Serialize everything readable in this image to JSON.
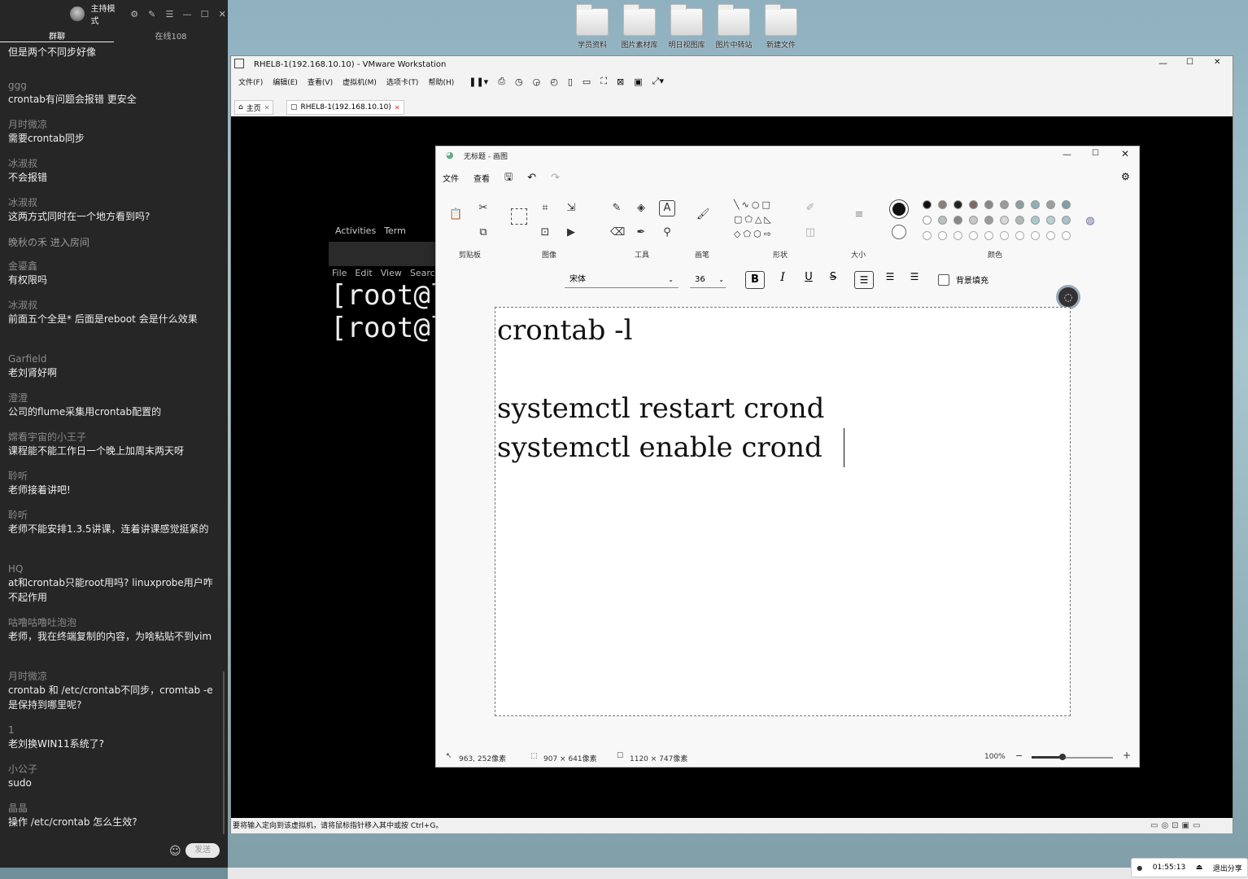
{
  "chat": {
    "mode_label": "主持模式",
    "tabs": [
      "群聊",
      "在线108"
    ],
    "messages": [
      {
        "name": "",
        "text": "但是两个不同步好像"
      },
      {
        "name": "ggg",
        "text": "crontab有问题会报错  更安全"
      },
      {
        "name": "月时微凉",
        "text": "需要crontab同步"
      },
      {
        "name": "冰淑叔",
        "text": "不会报错"
      },
      {
        "name": "冰淑叔",
        "text": "这两方式同时在一个地方看到吗?"
      },
      {
        "name": "",
        "text": "晚秋の禾 进入房间"
      },
      {
        "name": "金鎏鑫",
        "text": "有权限吗"
      },
      {
        "name": "冰淑叔",
        "text": "前面五个全是*  后面是reboot  会是什么效果"
      },
      {
        "name": "Garfield",
        "text": "老刘肾好啊"
      },
      {
        "name": "澄澄",
        "text": "公司的flume采集用crontab配置的"
      },
      {
        "name": "嫦看宇宙的小王子",
        "text": "课程能不能工作日一个晚上加周末两天呀"
      },
      {
        "name": "聆听",
        "text": "老师接着讲吧!"
      },
      {
        "name": "聆听",
        "text": "老师不能安排1.3.5讲课，连着讲课感觉挺紧的"
      },
      {
        "name": "HQ",
        "text": "at和crontab只能root用吗? linuxprobe用户咋不起作用"
      },
      {
        "name": "咕噜咕噜吐泡泡",
        "text": "老师，我在终端复制的内容，为啥粘贴不到vim"
      },
      {
        "name": "月时微凉",
        "text": "crontab 和 /etc/crontab不同步，cromtab -e是保持到哪里呢?"
      },
      {
        "name": "1",
        "text": "老刘换WIN11系统了?"
      },
      {
        "name": "小公子",
        "text": "sudo"
      },
      {
        "name": "晶晶",
        "text": "操作 /etc/crontab 怎么生效?"
      }
    ],
    "send_label": "发送"
  },
  "desktop": {
    "icons": [
      "学员资料",
      "图片素材库",
      "明日视图库",
      "图片中转站",
      "新建文件"
    ]
  },
  "vmware": {
    "title": "RHEL8-1(192.168.10.10) - VMware Workstation",
    "menu": [
      "文件(F)",
      "编辑(E)",
      "查看(V)",
      "虚拟机(M)",
      "选项卡(T)",
      "帮助(H)"
    ],
    "tabs": [
      "主页",
      "RHEL8-1(192.168.10.10)"
    ],
    "status": "要将输入定向到该虚拟机，请将鼠标指针移入其中或按 Ctrl+G。",
    "guest": {
      "activities": "Activities",
      "terminal_app": "Term",
      "term_menu": [
        "File",
        "Edit",
        "View",
        "Searc"
      ],
      "prompt_lines": [
        "[root@l",
        "[root@l"
      ]
    }
  },
  "paint": {
    "title": "无标题 - 画图",
    "menu": [
      "文件",
      "查看"
    ],
    "groups": [
      "剪贴板",
      "图像",
      "工具",
      "画笔",
      "形状",
      "大小",
      "颜色"
    ],
    "font_name": "宋体",
    "font_size": "36",
    "bg_fill_label": "背景填充",
    "canvas_lines": [
      "crontab -l",
      "systemctl restart crond",
      "systemctl enable crond"
    ],
    "status": {
      "cursor": "963, 252像素",
      "selection": "907 × 641像素",
      "canvas_size": "1120 × 747像素",
      "zoom": "100%"
    },
    "palette_row1": [
      "#111111",
      "#8a7f78",
      "#222222",
      "#7a6a60",
      "#888888",
      "#9a9a9a",
      "#8e9ea0",
      "#8fb0b8",
      "#9aa0a0",
      "#7fa0a8"
    ],
    "palette_row2": [
      "#ffffff",
      "#b8c0c0",
      "#888888",
      "#c8c8c8",
      "#9a9a9a",
      "#d8d8d8",
      "#b0b8b8",
      "#a8c8d0",
      "#b8d0d8",
      "#a8c0c8"
    ]
  },
  "sharebar": {
    "time": "01:55:13",
    "exit_label": "退出分享"
  }
}
